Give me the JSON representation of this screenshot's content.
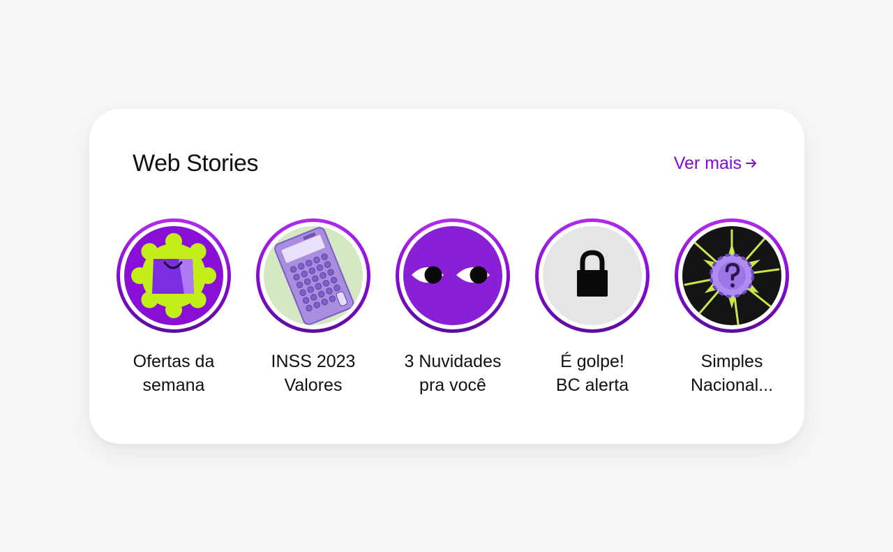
{
  "section": {
    "title": "Web Stories",
    "more_label": "Ver mais",
    "more_icon": "arrow-right-icon",
    "accent": "#820ad1"
  },
  "stories": [
    {
      "line1": "Ofertas da",
      "line2": "semana",
      "icon": "shopping-bag-icon"
    },
    {
      "line1": "INSS 2023",
      "line2": "Valores",
      "icon": "calculator-icon"
    },
    {
      "line1": "3 Nuvidades",
      "line2": "pra você",
      "icon": "eyes-icon"
    },
    {
      "line1": "É golpe!",
      "line2": "BC alerta",
      "icon": "padlock-icon"
    },
    {
      "line1": "Simples",
      "line2": "Nacional...",
      "icon": "question-coin-icon"
    }
  ]
}
